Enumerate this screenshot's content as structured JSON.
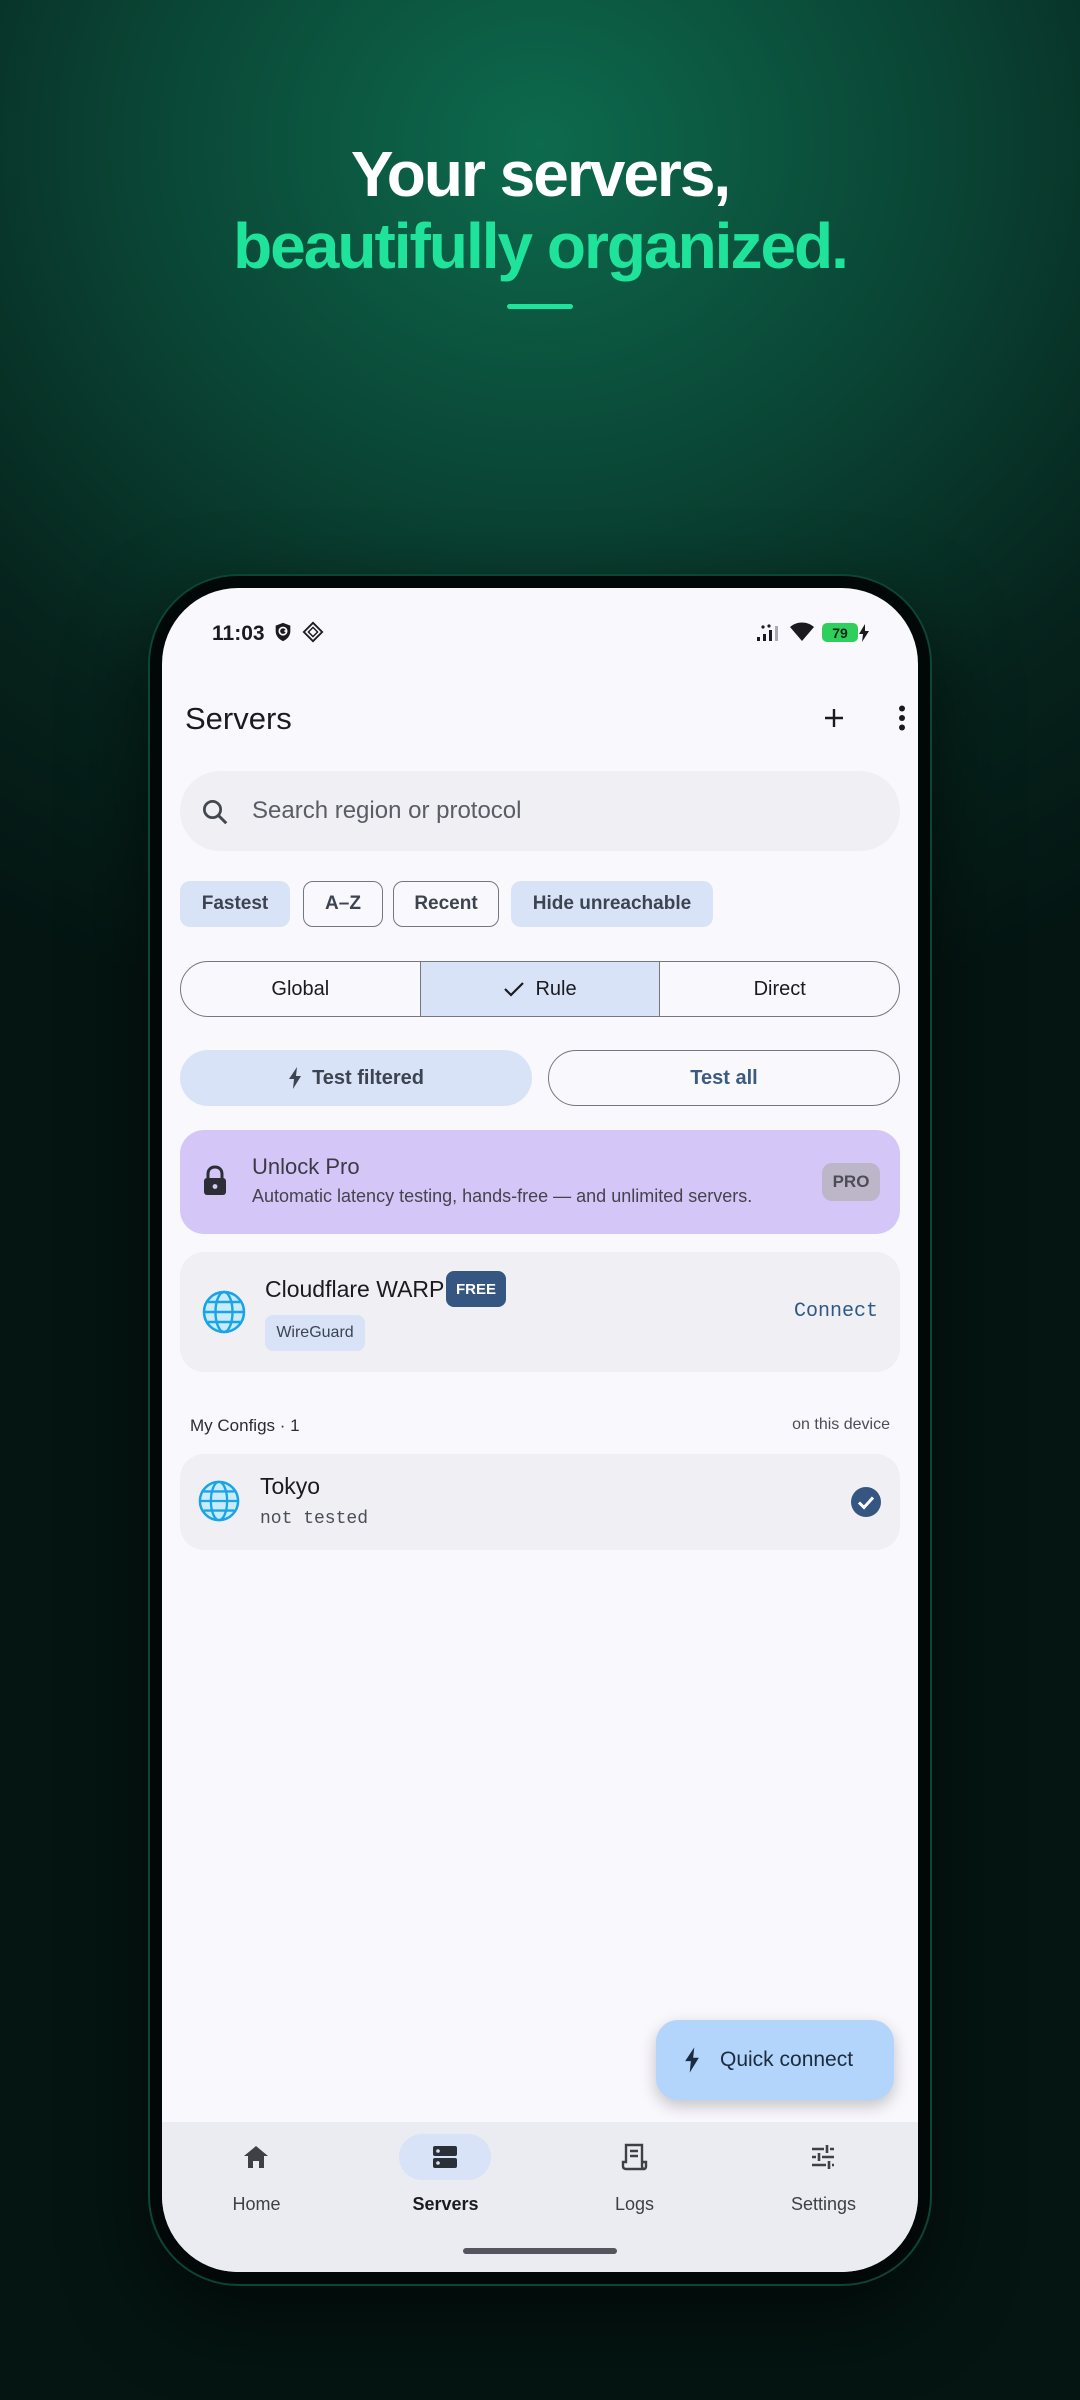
{
  "promo": {
    "headline_line1": "Your servers,",
    "headline_line2": "beautifully organized.",
    "accent_color": "#1fe39a"
  },
  "status_bar": {
    "time": "11:03",
    "battery_level": "79",
    "icons": [
      "vpn-key-icon",
      "data-saver-icon",
      "signal-icon",
      "wifi-icon",
      "battery-icon",
      "charging-icon"
    ]
  },
  "app_bar": {
    "title": "Servers",
    "actions": [
      "add-icon",
      "more-vert-icon"
    ]
  },
  "search": {
    "placeholder": "Search region or protocol",
    "value": ""
  },
  "sort_chips": [
    {
      "label": "Fastest",
      "selected": true
    },
    {
      "label": "A–Z",
      "selected": false
    },
    {
      "label": "Recent",
      "selected": false
    },
    {
      "label": "Hide unreachable",
      "selected": true
    }
  ],
  "routing_mode": {
    "options": [
      "Global",
      "Rule",
      "Direct"
    ],
    "selected": "Rule"
  },
  "test_buttons": {
    "filtered": "Test filtered",
    "all": "Test all"
  },
  "pro_card": {
    "title": "Unlock Pro",
    "subtitle": "Automatic latency testing, hands-free — and unlimited servers.",
    "badge": "PRO"
  },
  "featured_server": {
    "name": "Cloudflare WARP",
    "badge": "FREE",
    "protocol": "WireGuard",
    "action": "Connect"
  },
  "configs_section": {
    "title": "My Configs · 1",
    "location": "on this device",
    "items": [
      {
        "name": "Tokyo",
        "status": "not tested",
        "selected": true
      }
    ]
  },
  "fab": {
    "label": "Quick connect"
  },
  "bottom_nav": {
    "items": [
      {
        "label": "Home",
        "icon": "home-icon"
      },
      {
        "label": "Servers",
        "icon": "servers-icon"
      },
      {
        "label": "Logs",
        "icon": "logs-icon"
      },
      {
        "label": "Settings",
        "icon": "settings-sliders-icon"
      }
    ],
    "active": "Servers"
  }
}
